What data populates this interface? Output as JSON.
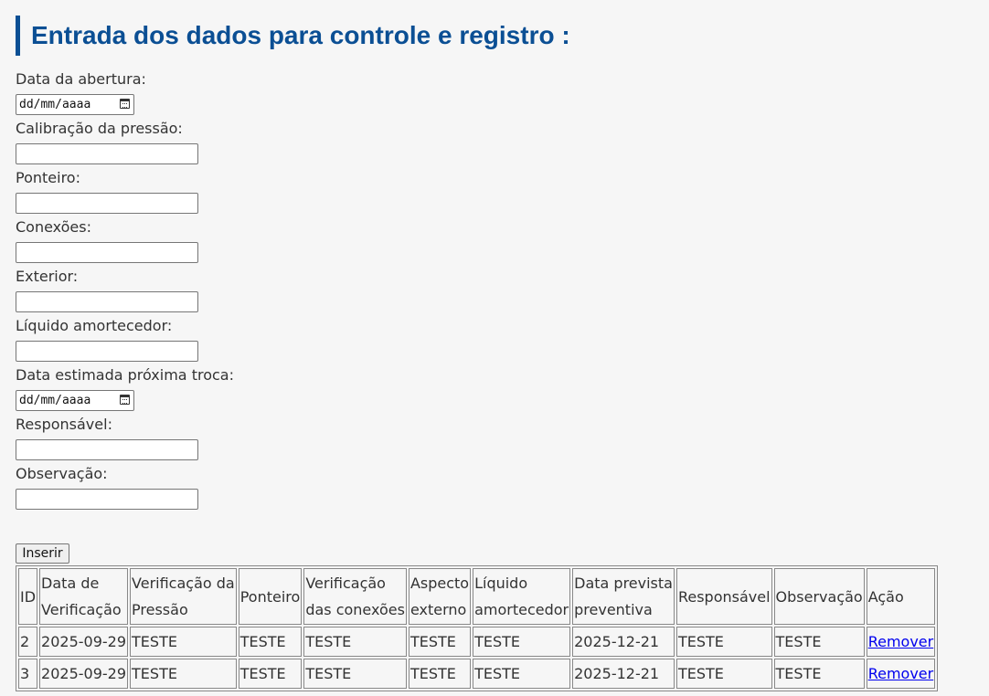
{
  "page": {
    "title": "Entrada dos dados para controle e registro :"
  },
  "form": {
    "opening_date": {
      "label": "Data da abertura:",
      "placeholder": "dd/mm/aaaa"
    },
    "pressure_calibration": {
      "label": "Calibração da pressão:",
      "value": ""
    },
    "pointer": {
      "label": "Ponteiro:",
      "value": ""
    },
    "connections": {
      "label": "Conexões:",
      "value": ""
    },
    "exterior": {
      "label": "Exterior:",
      "value": ""
    },
    "damping_liquid": {
      "label": "Líquido amortecedor:",
      "value": ""
    },
    "next_change_date": {
      "label": "Data estimada próxima troca:",
      "placeholder": "dd/mm/aaaa"
    },
    "responsible": {
      "label": "Responsável:",
      "value": ""
    },
    "observation": {
      "label": "Observação:",
      "value": ""
    },
    "submit_label": "Inserir"
  },
  "table": {
    "headers": {
      "id": "ID",
      "date": [
        "Data de",
        "Verificação"
      ],
      "pressure": [
        "Verificação da",
        "Pressão"
      ],
      "pointer": "Ponteiro",
      "connections": [
        "Verificação",
        "das conexões"
      ],
      "external": [
        "Aspecto",
        "externo"
      ],
      "liquid": [
        "Líquido",
        "amortecedor"
      ],
      "preventive": [
        "Data prevista",
        "preventiva"
      ],
      "responsible": "Responsável",
      "observation": "Observação",
      "action": "Ação"
    },
    "rows": [
      {
        "id": "2",
        "date": "2025-09-29",
        "pressure": "TESTE",
        "pointer": "TESTE",
        "connections": "TESTE",
        "external": "TESTE",
        "liquid": "TESTE",
        "preventive": "2025-12-21",
        "responsible": "TESTE",
        "observation": "TESTE",
        "action": "Remover"
      },
      {
        "id": "3",
        "date": "2025-09-29",
        "pressure": "TESTE",
        "pointer": "TESTE",
        "connections": "TESTE",
        "external": "TESTE",
        "liquid": "TESTE",
        "preventive": "2025-12-21",
        "responsible": "TESTE",
        "observation": "TESTE",
        "action": "Remover"
      }
    ]
  },
  "icons": {
    "date_picker": "calendar-icon"
  },
  "colors": {
    "title": "#0b4f94",
    "link": "#0000ee",
    "background": "#f6f6f6"
  }
}
